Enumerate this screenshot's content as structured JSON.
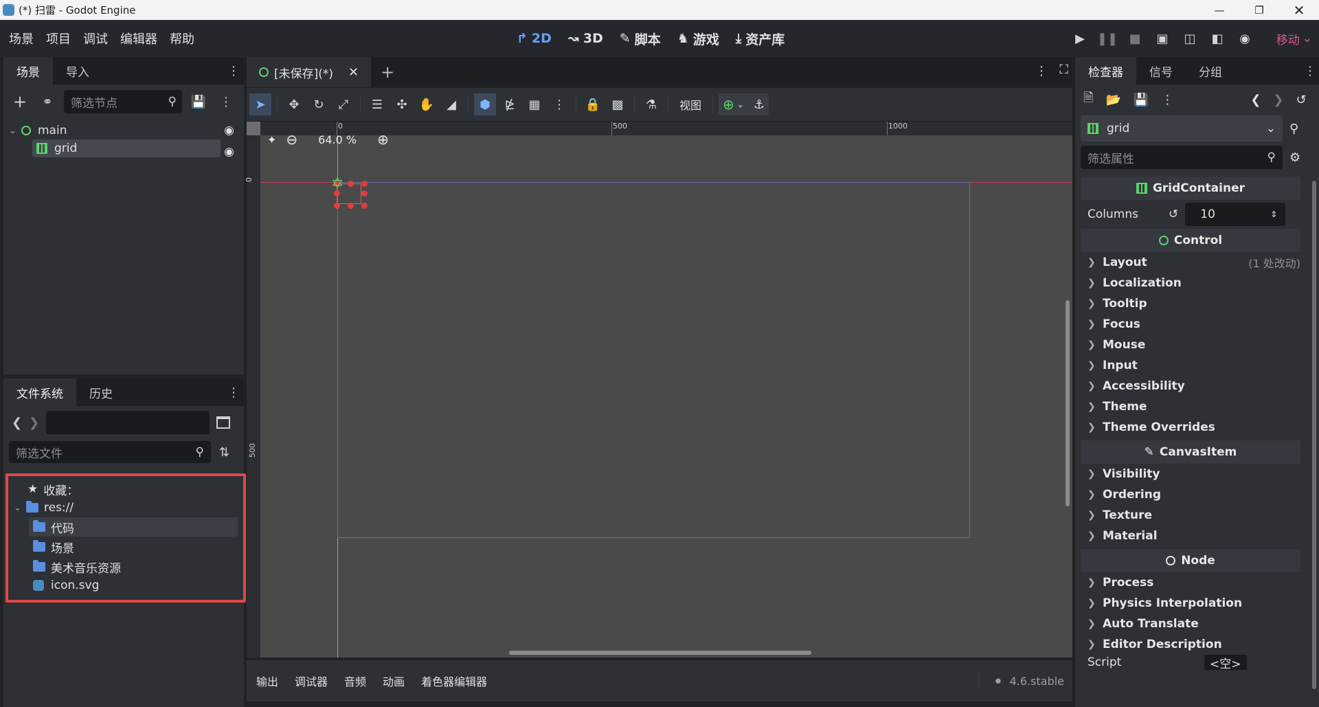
{
  "window": {
    "title": "(*) 扫雷 - Godot Engine"
  },
  "menu": {
    "items": [
      "场景",
      "项目",
      "调试",
      "编辑器",
      "帮助"
    ]
  },
  "workspaces": {
    "d2": "2D",
    "d3": "3D",
    "script": "脚本",
    "game": "游戏",
    "assetlib": "资产库"
  },
  "renderer": "移动",
  "scene_dock": {
    "tab_scene": "场景",
    "tab_import": "导入",
    "filter_placeholder": "筛选节点",
    "nodes": [
      {
        "name": "main"
      },
      {
        "name": "grid"
      }
    ]
  },
  "fs_dock": {
    "tab_fs": "文件系统",
    "tab_history": "历史",
    "filter_placeholder": "筛选文件",
    "favorites": "收藏：",
    "root": "res://",
    "items": [
      "代码",
      "场景",
      "美术音乐资源",
      "icon.svg"
    ]
  },
  "editor_tab": {
    "label": "[未保存](*)"
  },
  "toolbar": {
    "view_label": "视图"
  },
  "viewport": {
    "zoom": "64.0 %",
    "ruler_h": [
      "0",
      "500",
      "1000"
    ],
    "ruler_v": [
      "0",
      "500"
    ]
  },
  "bottom": {
    "tabs": [
      "输出",
      "调试器",
      "音频",
      "动画",
      "着色器编辑器"
    ],
    "version": "4.6.stable"
  },
  "inspector": {
    "tabs": [
      "检查器",
      "信号",
      "分组"
    ],
    "node_name": "grid",
    "filter_placeholder": "筛选属性",
    "class_grid": "GridContainer",
    "columns_label": "Columns",
    "columns_value": "10",
    "class_control": "Control",
    "control_props": [
      "Layout",
      "Localization",
      "Tooltip",
      "Focus",
      "Mouse",
      "Input",
      "Accessibility",
      "Theme",
      "Theme Overrides"
    ],
    "layout_note": "(1 处改动)",
    "class_canvas": "CanvasItem",
    "canvas_props": [
      "Visibility",
      "Ordering",
      "Texture",
      "Material"
    ],
    "class_node": "Node",
    "node_props": [
      "Process",
      "Physics Interpolation",
      "Auto Translate",
      "Editor Description"
    ],
    "script_label": "Script",
    "script_value": "<空>"
  },
  "colors": {
    "accent": "#5fa3f5",
    "highlight_box": "#e04848",
    "renderer": "#d8578f",
    "grid_icon": "#59d26a",
    "node_ring": "#5fd36b"
  }
}
